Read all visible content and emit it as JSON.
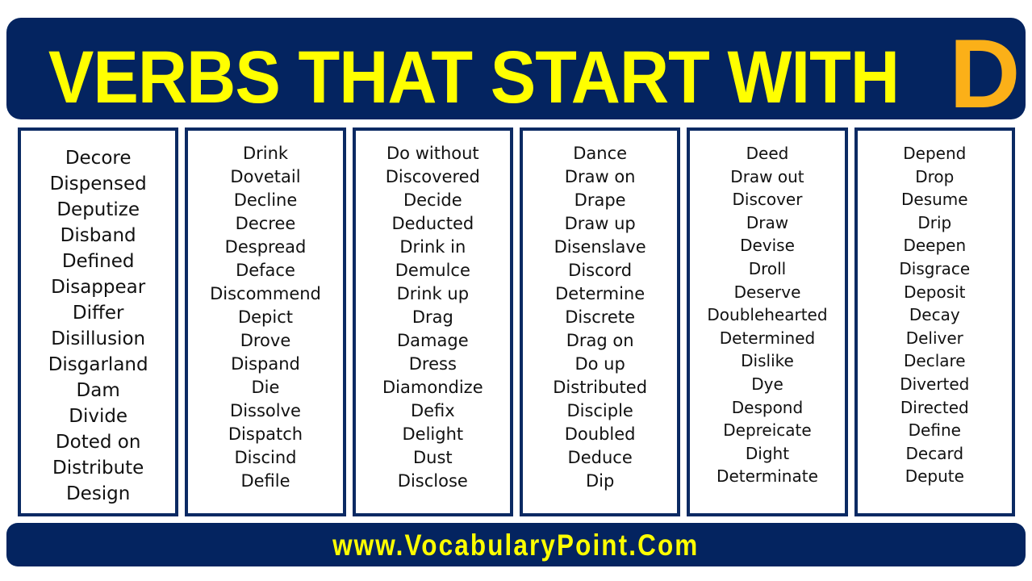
{
  "header": {
    "title_main": "VERBS THAT START WITH",
    "title_letter": "D",
    "bg_color": "#042460",
    "title_color": "#FFFF00",
    "letter_color": "#FBB018"
  },
  "footer": {
    "website": "www.VocabularyPoint.Com",
    "bg_color": "#042460",
    "text_color": "#FFFF00"
  },
  "columns": [
    {
      "id": "column-1",
      "words": [
        "Decore",
        "Dispensed",
        "Deputize",
        "Disband",
        "Defined",
        "Disappear",
        "Differ",
        "Disillusion",
        "Disgarland",
        "Dam",
        "Divide",
        "Doted on",
        "Distribute",
        "Design"
      ]
    },
    {
      "id": "column-2",
      "words": [
        "Drink",
        "Dovetail",
        "Decline",
        "Decree",
        "Despread",
        "Deface",
        "Discommend",
        "Depict",
        "Drove",
        "Dispand",
        "Die",
        "Dissolve",
        "Dispatch",
        "Discind",
        "Defile"
      ]
    },
    {
      "id": "column-3",
      "words": [
        "Do without",
        "Discovered",
        "Decide",
        "Deducted",
        "Drink in",
        "Demulce",
        "Drink up",
        "Drag",
        "Damage",
        "Dress",
        "Diamondize",
        "Defix",
        "Delight",
        "Dust",
        "Disclose"
      ]
    },
    {
      "id": "column-4",
      "words": [
        "Dance",
        "Draw on",
        "Drape",
        "Draw up",
        "Disenslave",
        "Discord",
        "Determine",
        "Discrete",
        "Drag on",
        "Do up",
        "Distributed",
        "Disciple",
        "Doubled",
        "Deduce",
        "Dip"
      ]
    },
    {
      "id": "column-5",
      "words": [
        "Deed",
        "Draw out",
        "Discover",
        "Draw",
        "Devise",
        "Droll",
        "Deserve",
        "Doublehearted",
        "Determined",
        "Dislike",
        "Dye",
        "Despond",
        "Depreicate",
        "Dight",
        "Determinate"
      ]
    },
    {
      "id": "column-6",
      "words": [
        "Depend",
        "Drop",
        "Desume",
        "Drip",
        "Deepen",
        "Disgrace",
        "Deposit",
        "Decay",
        "Deliver",
        "Declare",
        "Diverted",
        "Directed",
        "Define",
        "Decard",
        "Depute"
      ]
    }
  ]
}
